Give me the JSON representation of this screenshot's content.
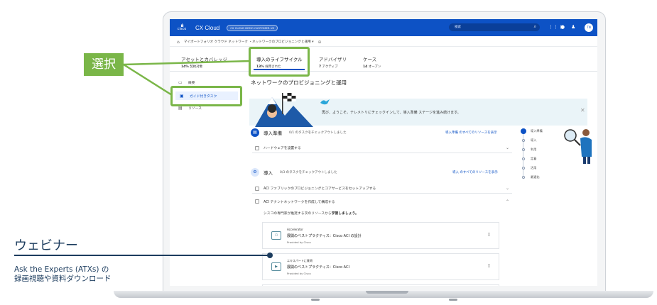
{
  "app": {
    "logo_text": "cisco",
    "title": "CX Cloud",
    "tenant": "CX CLOUD DEMO CUSTOMER US",
    "search_placeholder": "検索",
    "avatar_initials": "TN"
  },
  "breadcrumb": {
    "text": "マイポートフォリオ クラウド ネットワーク ・ネットワークのプロビジョニングと運用 ▾"
  },
  "tabs": [
    {
      "label": "アセットとカバレッジ",
      "sub_value": "14%",
      "sub_text": "契約対象"
    },
    {
      "label": "導入のライフサイクル",
      "sub_value": "13%",
      "sub_text": "採用された"
    },
    {
      "label": "アドバイザリ",
      "sub_value": "7",
      "sub_text": "アクティブ"
    },
    {
      "label": "ケース",
      "sub_value": "14",
      "sub_text": "オープン"
    }
  ],
  "sidebar": {
    "items": [
      {
        "label": "概要",
        "icon": "overview-icon"
      },
      {
        "label": "ガイド付きタスク",
        "icon": "guided-task-icon"
      },
      {
        "label": "リソース",
        "icon": "resources-icon"
      }
    ]
  },
  "main": {
    "heading": "ネットワークのプロビジョニングと運用",
    "banner_text": "再び、ようこそ。テレメトリにチェックインして、導入準備 ステージを進み続けます。",
    "sections": [
      {
        "title": "導入準備",
        "count": "0/1 のタスクをチェックアウトしました",
        "link": "導入準備 のすべてのリソースを表示",
        "tasks": [
          "ハードウェアを設置する"
        ]
      },
      {
        "title": "導入",
        "count": "0/3 のタスクをチェックアウトしました",
        "link": "導入 のすべてのリソースを表示",
        "tasks": [
          "ACI ファブリックのプロビジョニングとコアサービスをセットアップする",
          "ACI テナントネットワークを作成して構成する"
        ]
      }
    ],
    "learn_prefix": "シスコの専門家が推奨する次のリソースから",
    "learn_bold": "学習しましょう。",
    "cards": [
      {
        "kind": "Accelerator",
        "title": "展開のベストプラクティス：Cisco ACI の設計",
        "provider": "Provided by Cisco"
      },
      {
        "kind": "エキスパートに質問",
        "title": "展開のベストプラクティス：Cisco ACI",
        "provider": "Provided by Cisco"
      }
    ]
  },
  "stepper": [
    "導入準備",
    "導入",
    "利用",
    "定着",
    "活用",
    "最適化"
  ],
  "annotations": {
    "select_label": "選択",
    "webinar_heading": "ウェビナー",
    "webinar_line1": "Ask the Experts (ATXs) の",
    "webinar_line2": "録画視聴や資料ダウンロード",
    "accent_green": "#7ab648",
    "accent_navy": "#1c3c5e"
  }
}
